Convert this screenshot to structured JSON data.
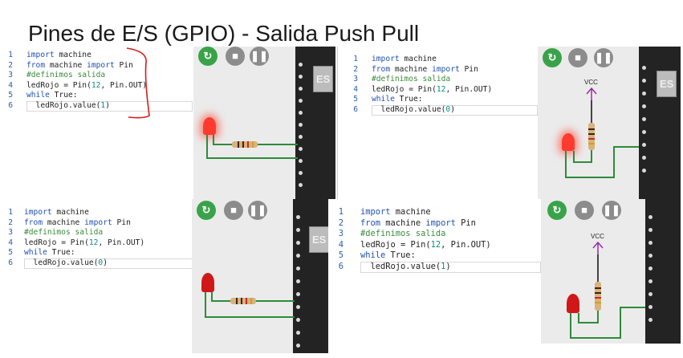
{
  "title": "Pines de E/S (GPIO) - Salida Push Pull",
  "panels": [
    {
      "line_numbers": [
        "1",
        "2",
        "3",
        "4",
        "5",
        "6"
      ],
      "code": {
        "l1_kw": "import",
        "l1_rest": " machine",
        "l2_kw1": "from",
        "l2_mid": " machine ",
        "l2_kw2": "import",
        "l2_rest": " Pin",
        "l3": "#definimos salida",
        "l4_a": "ledRojo = Pin(",
        "l4_num": "12",
        "l4_b": ", Pin.OUT)",
        "l5_kw": "while",
        "l5_rest": " True:",
        "l6_a": "  ledRojo.value(",
        "l6_num": "1",
        "l6_b": ")"
      },
      "led_on": true,
      "vcc": ""
    },
    {
      "line_numbers": [
        "1",
        "2",
        "3",
        "4",
        "5",
        "6"
      ],
      "code": {
        "l1_kw": "import",
        "l1_rest": " machine",
        "l2_kw1": "from",
        "l2_mid": " machine ",
        "l2_kw2": "import",
        "l2_rest": " Pin",
        "l3": "#definimos salida",
        "l4_a": "ledRojo = Pin(",
        "l4_num": "12",
        "l4_b": ", Pin.OUT)",
        "l5_kw": "while",
        "l5_rest": " True:",
        "l6_a": "  ledRojo.value(",
        "l6_num": "0",
        "l6_b": ")"
      },
      "led_on": true,
      "vcc": "VCC"
    },
    {
      "line_numbers": [
        "1",
        "2",
        "3",
        "4",
        "5",
        "6"
      ],
      "code": {
        "l1_kw": "import",
        "l1_rest": " machine",
        "l2_kw1": "from",
        "l2_mid": " machine ",
        "l2_kw2": "import",
        "l2_rest": " Pin",
        "l3": "#definimos salida",
        "l4_a": "ledRojo = Pin(",
        "l4_num": "12",
        "l4_b": ", Pin.OUT)",
        "l5_kw": "while",
        "l5_rest": " True:",
        "l6_a": "  ledRojo.value(",
        "l6_num": "0",
        "l6_b": ")"
      },
      "led_on": false,
      "vcc": ""
    },
    {
      "line_numbers": [
        "1",
        "2",
        "3",
        "4",
        "5",
        "6"
      ],
      "code": {
        "l1_kw": "import",
        "l1_rest": " machine",
        "l2_kw1": "from",
        "l2_mid": " machine ",
        "l2_kw2": "import",
        "l2_rest": " Pin",
        "l3": "#definimos salida",
        "l4_a": "ledRojo = Pin(",
        "l4_num": "12",
        "l4_b": ", Pin.OUT)",
        "l5_kw": "while",
        "l5_rest": " True:",
        "l6_a": "  ledRojo.value(",
        "l6_num": "1",
        "l6_b": ")"
      },
      "led_on": false,
      "vcc": "VCC"
    }
  ],
  "board_label": "ES",
  "icons": {
    "run": "restart-icon",
    "stop": "stop-icon",
    "pause": "pause-icon"
  },
  "colors": {
    "led_on": "#ff3b30",
    "led_off": "#d01818",
    "wire": "#2e8b3a",
    "run": "#3aa34a",
    "board": "#232323"
  }
}
